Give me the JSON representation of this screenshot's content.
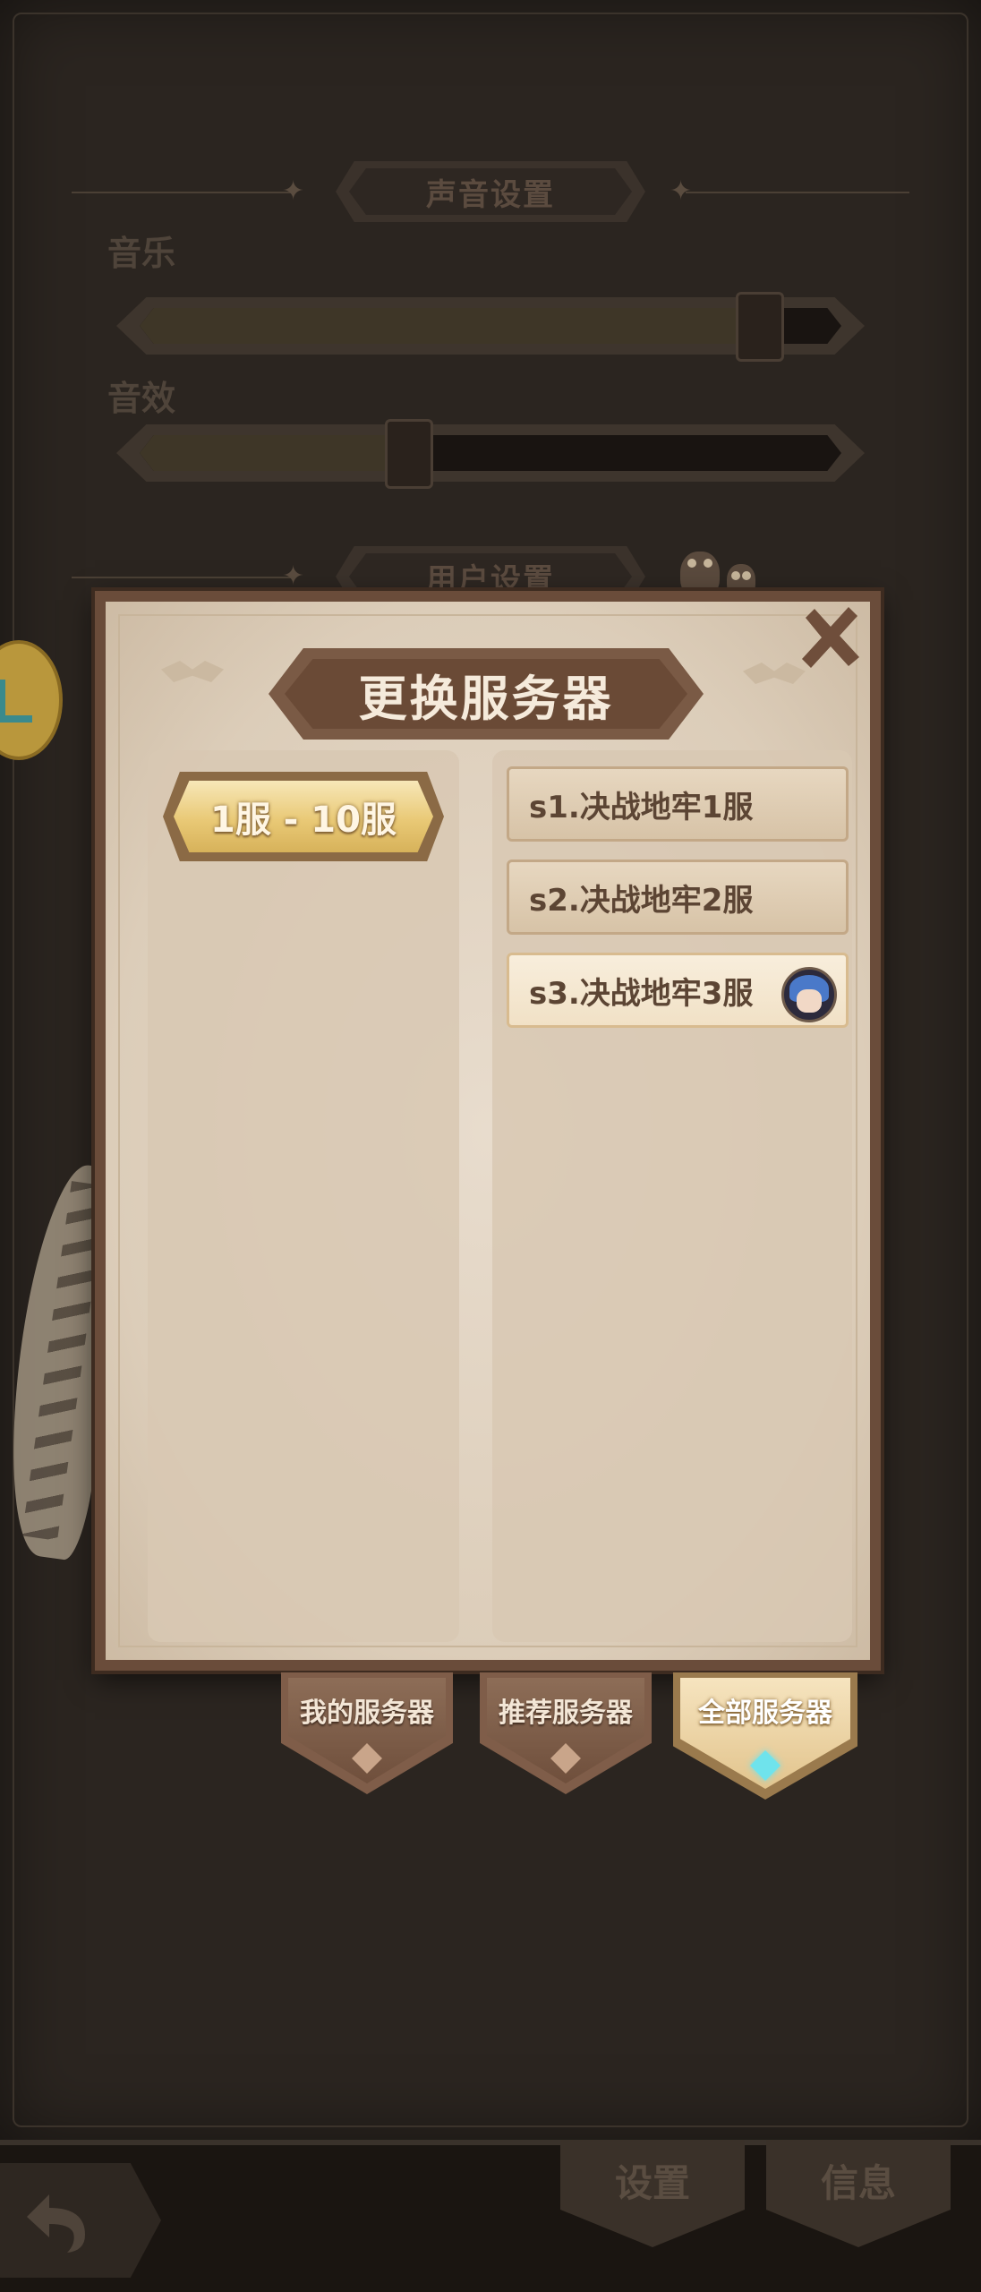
{
  "background": {
    "sound_section_title": "声音设置",
    "music_label": "音乐",
    "music_volume": 0.88,
    "sfx_label": "音效",
    "sfx_volume": 0.38,
    "user_section_title": "用户设置",
    "bottom_tabs": [
      "设置",
      "信息"
    ]
  },
  "modal": {
    "title": "更换服务器",
    "range_button": "1服 - 10服",
    "servers": [
      {
        "label": "s1.决战地牢1服",
        "selected": false
      },
      {
        "label": "s2.决战地牢2服",
        "selected": false
      },
      {
        "label": "s3.决战地牢3服",
        "selected": true
      }
    ],
    "tabs": [
      {
        "label": "我的服务器",
        "active": false
      },
      {
        "label": "推荐服务器",
        "active": false
      },
      {
        "label": "全部服务器",
        "active": true
      }
    ]
  },
  "colors": {
    "accent_gold": "#e9c976",
    "gem_active": "#6fe3ec",
    "panel_brown": "#6a4c3a"
  }
}
